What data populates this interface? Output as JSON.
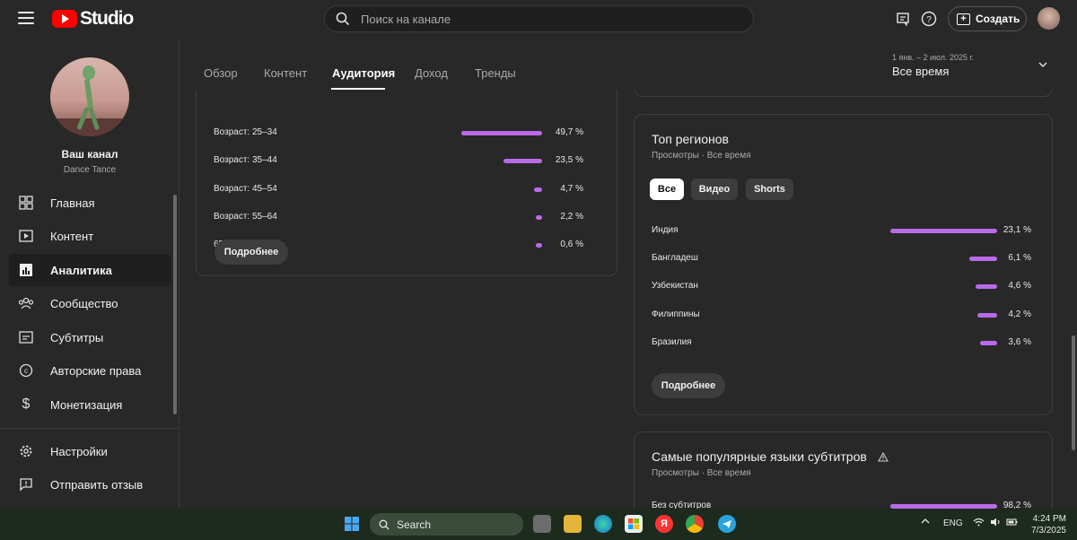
{
  "header": {
    "logo_text": "Studio",
    "search_placeholder": "Поиск на канале",
    "create_label": "Создать"
  },
  "sidebar": {
    "channel_name": "Ваш канал",
    "channel_sub": "Dance Tance",
    "items": [
      {
        "label": "Главная",
        "icon": "dashboard-icon"
      },
      {
        "label": "Контент",
        "icon": "content-icon"
      },
      {
        "label": "Аналитика",
        "icon": "analytics-icon",
        "active": true
      },
      {
        "label": "Сообщество",
        "icon": "community-icon"
      },
      {
        "label": "Субтитры",
        "icon": "subtitles-icon"
      },
      {
        "label": "Авторские права",
        "icon": "copyright-icon"
      },
      {
        "label": "Монетизация",
        "icon": "monetization-icon"
      }
    ],
    "bottom_items": [
      {
        "label": "Настройки",
        "icon": "settings-icon"
      },
      {
        "label": "Отправить отзыв",
        "icon": "feedback-icon"
      }
    ]
  },
  "tabs": [
    "Обзор",
    "Контент",
    "Аудитория",
    "Доход",
    "Тренды"
  ],
  "active_tab": "Аудитория",
  "date": {
    "range": "1 янв. – 2 июл. 2025 г.",
    "label": "Все время"
  },
  "age_card": {
    "rows": [
      {
        "label": "Возраст: 25–34",
        "value": 49.7,
        "pct": "49,7 %"
      },
      {
        "label": "Возраст: 35–44",
        "value": 23.5,
        "pct": "23,5 %"
      },
      {
        "label": "Возраст: 45–54",
        "value": 4.7,
        "pct": "4,7 %"
      },
      {
        "label": "Возраст: 55–64",
        "value": 2.2,
        "pct": "2,2 %"
      },
      {
        "label": "65 и старше",
        "value": 0.6,
        "pct": "0,6 %"
      }
    ],
    "more_label": "Подробнее"
  },
  "regions_card": {
    "title": "Топ регионов",
    "subtitle": "Просмотры · Все время",
    "chips": [
      "Все",
      "Видео",
      "Shorts"
    ],
    "active_chip": "Все",
    "rows": [
      {
        "label": "Индия",
        "value": 23.1,
        "pct": "23,1 %"
      },
      {
        "label": "Бангладеш",
        "value": 6.1,
        "pct": "6,1 %"
      },
      {
        "label": "Узбекистан",
        "value": 4.6,
        "pct": "4,6 %"
      },
      {
        "label": "Филиппины",
        "value": 4.2,
        "pct": "4,2 %"
      },
      {
        "label": "Бразилия",
        "value": 3.6,
        "pct": "3,6 %"
      }
    ],
    "more_label": "Подробнее"
  },
  "subtitles_card": {
    "title": "Самые популярные языки субтитров",
    "subtitle": "Просмотры · Все время",
    "rows": [
      {
        "label": "Без субтитров",
        "value": 98.2,
        "pct": "98,2 %"
      }
    ]
  },
  "taskbar": {
    "search_label": "Search",
    "lang": "ENG",
    "time": "4:24 PM",
    "date": "7/3/2025"
  },
  "colors": {
    "accent_bar": "#b96ae8",
    "background": "#282828",
    "brand_red": "#ff0000"
  }
}
